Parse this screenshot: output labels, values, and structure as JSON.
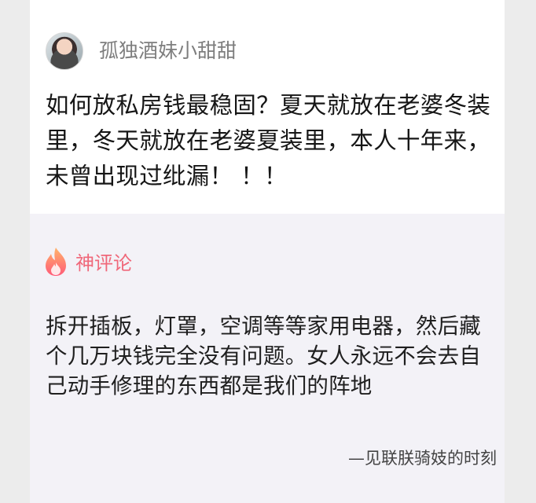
{
  "post": {
    "username": "孤独酒妹小甜甜",
    "text": "如何放私房钱最稳固？夏天就放在老婆冬装里，冬天就放在老婆夏装里，本人十年来，未曾出现过纰漏！ ！！"
  },
  "comment": {
    "section_label": "神评论",
    "text": "拆开插板，灯罩，空调等等家用电器，然后藏个几万块钱完全没有问题。女人永远不会去自己动手修理的东西都是我们的阵地",
    "signature": "—见联朕骑妓的时刻"
  },
  "colors": {
    "accent": "#f0687a",
    "comment_bg": "#f3f2f7",
    "page_bg": "#ececec"
  },
  "icons": {
    "avatar": "user-avatar",
    "hot": "fire-icon"
  }
}
